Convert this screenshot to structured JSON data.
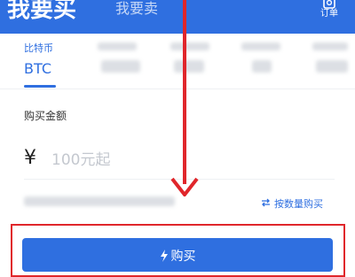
{
  "header": {
    "buy_tab": "我要买",
    "sell_tab": "我要卖",
    "order_label": "订单",
    "order_icon": "order-list-icon"
  },
  "coins": {
    "active": {
      "name": "比特币",
      "symbol": "BTC"
    },
    "others_blurred": true
  },
  "form": {
    "amount_label": "购买金额",
    "currency_symbol": "¥",
    "amount_placeholder": "100元起",
    "amount_value": ""
  },
  "switch_mode": {
    "icon": "swap-arrows-icon",
    "label": "按数量购买"
  },
  "buy_button": {
    "icon": "lightning-icon",
    "label": "购买"
  },
  "colors": {
    "brand": "#2f6fe0",
    "annotation": "#e0262b"
  }
}
